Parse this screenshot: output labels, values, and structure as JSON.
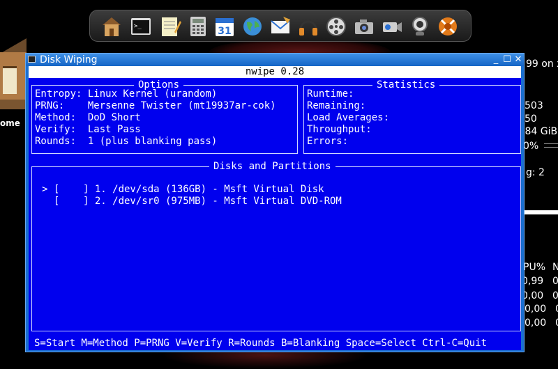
{
  "desktop": {
    "home_label": "ome",
    "dock_icons": [
      "home-folder-icon",
      "terminal-icon",
      "text-editor-icon",
      "calculator-icon",
      "calendar-icon",
      "globe-icon",
      "mail-icon",
      "headphones-icon",
      "film-reel-icon",
      "camera-icon",
      "video-camera-icon",
      "webcam-icon",
      "xfce-settings-icon"
    ],
    "calendar_day": "31",
    "side_panel": {
      "lines": [
        "99 on x",
        "503",
        "50",
        ",84 GiB",
        "0%",
        "g: 2",
        "PU%",
        "0,99",
        "0,00",
        "0,00",
        "0,00"
      ],
      "col2": [
        "N",
        "0",
        "0",
        "0",
        "0"
      ]
    }
  },
  "window": {
    "title": "Disk Wiping",
    "controls": {
      "minimize": "_",
      "maximize": "☐",
      "close": "✕"
    }
  },
  "nwipe": {
    "header": "nwipe 0.28",
    "options": {
      "title": "Options",
      "rows": [
        "Entropy: Linux Kernel (urandom)",
        "PRNG:    Mersenne Twister (mt19937ar-cok)",
        "Method:  DoD Short",
        "Verify:  Last Pass",
        "Rounds:  1 (plus blanking pass)"
      ]
    },
    "statistics": {
      "title": "Statistics",
      "rows": [
        "Runtime:",
        "Remaining:",
        "Load Averages:",
        "Throughput:",
        "Errors:"
      ]
    },
    "disks": {
      "title": "Disks and Partitions",
      "items": [
        "> [    ] 1. /dev/sda (136GB) - Msft Virtual Disk",
        "  [    ] 2. /dev/sr0 (975MB) - Msft Virtual DVD-ROM"
      ]
    },
    "footer": "S=Start M=Method P=PRNG V=Verify R=Rounds B=Blanking Space=Select Ctrl-C=Quit"
  }
}
